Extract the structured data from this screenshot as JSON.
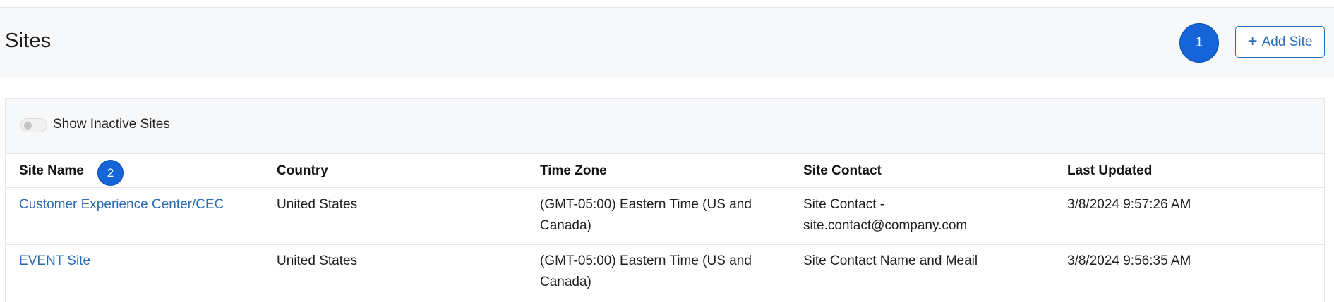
{
  "header": {
    "title": "Sites",
    "badge_1": "1",
    "add_button_label": "Add Site",
    "add_button_icon": "plus-icon"
  },
  "filters": {
    "show_inactive_label": "Show Inactive Sites",
    "show_inactive_checked": false
  },
  "table": {
    "badge_2": "2",
    "columns": [
      "Site Name",
      "Country",
      "Time Zone",
      "Site Contact",
      "Last Updated"
    ],
    "rows": [
      {
        "site_name": "Customer Experience Center/CEC",
        "country": "United States",
        "time_zone": "(GMT-05:00) Eastern Time (US and Canada)",
        "site_contact": "Site Contact - site.contact@company.com",
        "last_updated": "3/8/2024 9:57:26 AM"
      },
      {
        "site_name": "EVENT Site",
        "country": "United States",
        "time_zone": "(GMT-05:00) Eastern Time (US and Canada)",
        "site_contact": "Site Contact Name and Meail",
        "last_updated": "3/8/2024 9:56:35 AM"
      }
    ]
  },
  "colors": {
    "accent": "#2a6db7",
    "badge": "#1565d8",
    "header_bg": "#f7f8f9"
  }
}
